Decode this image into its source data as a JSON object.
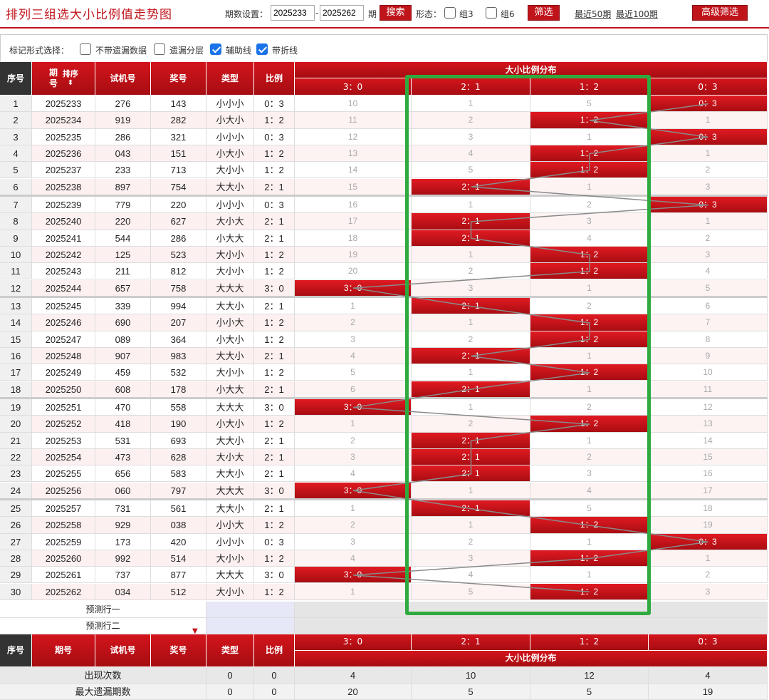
{
  "title": "排列三组选大小比例值走势图",
  "toolbar": {
    "period_label": "期数设置：",
    "from_value": "2025233",
    "dash": "-",
    "to_value": "2025262",
    "period_suffix": "期",
    "search_label": "搜索",
    "shape_label": "形态：",
    "group3_label": "组3",
    "group6_label": "组6",
    "filter_label": "筛选",
    "recent50_label": "最近50期",
    "recent100_label": "最近100期",
    "advanced_label": "高级筛选"
  },
  "options": {
    "label": "标记形式选择：",
    "items": [
      {
        "label": "不带遗漏数据",
        "checked": false
      },
      {
        "label": "遗漏分层",
        "checked": false
      },
      {
        "label": "辅助线",
        "checked": true
      },
      {
        "label": "带折线",
        "checked": true
      }
    ]
  },
  "header": {
    "seq": "序号",
    "period": "期号",
    "sort": "排序",
    "trial": "试机号",
    "prize": "奖号",
    "type": "类型",
    "ratio": "比例",
    "dist_title": "大小比例分布",
    "dist_cols": [
      "3：0",
      "2：1",
      "1：2",
      "0：3"
    ]
  },
  "colors": {
    "brand_red": "#c0141b",
    "highlight_green": "#2faa3f"
  },
  "rows": [
    {
      "seq": "1",
      "period": "2025233",
      "trial": "276",
      "prize": "143",
      "type": "小小小",
      "ratio": "0：3",
      "dist": [
        "10",
        "1",
        "5",
        "0：3"
      ],
      "hit": 3
    },
    {
      "seq": "2",
      "period": "2025234",
      "trial": "919",
      "prize": "282",
      "type": "小大小",
      "ratio": "1：2",
      "dist": [
        "11",
        "2",
        "1：2",
        "1"
      ],
      "hit": 2
    },
    {
      "seq": "3",
      "period": "2025235",
      "trial": "286",
      "prize": "321",
      "type": "小小小",
      "ratio": "0：3",
      "dist": [
        "12",
        "3",
        "1",
        "0：3"
      ],
      "hit": 3
    },
    {
      "seq": "4",
      "period": "2025236",
      "trial": "043",
      "prize": "151",
      "type": "小大小",
      "ratio": "1：2",
      "dist": [
        "13",
        "4",
        "1：2",
        "1"
      ],
      "hit": 2
    },
    {
      "seq": "5",
      "period": "2025237",
      "trial": "233",
      "prize": "713",
      "type": "大小小",
      "ratio": "1：2",
      "dist": [
        "14",
        "5",
        "1：2",
        "2"
      ],
      "hit": 2
    },
    {
      "seq": "6",
      "period": "2025238",
      "trial": "897",
      "prize": "754",
      "type": "大大小",
      "ratio": "2：1",
      "dist": [
        "15",
        "2：1",
        "1",
        "3"
      ],
      "hit": 1
    },
    {
      "seq": "7",
      "period": "2025239",
      "trial": "779",
      "prize": "220",
      "type": "小小小",
      "ratio": "0：3",
      "dist": [
        "16",
        "1",
        "2",
        "0：3"
      ],
      "hit": 3
    },
    {
      "seq": "8",
      "period": "2025240",
      "trial": "220",
      "prize": "627",
      "type": "大小大",
      "ratio": "2：1",
      "dist": [
        "17",
        "2：1",
        "3",
        "1"
      ],
      "hit": 1
    },
    {
      "seq": "9",
      "period": "2025241",
      "trial": "544",
      "prize": "286",
      "type": "小大大",
      "ratio": "2：1",
      "dist": [
        "18",
        "2：1",
        "4",
        "2"
      ],
      "hit": 1
    },
    {
      "seq": "10",
      "period": "2025242",
      "trial": "125",
      "prize": "523",
      "type": "大小小",
      "ratio": "1：2",
      "dist": [
        "19",
        "1",
        "1：2",
        "3"
      ],
      "hit": 2
    },
    {
      "seq": "11",
      "period": "2025243",
      "trial": "211",
      "prize": "812",
      "type": "大小小",
      "ratio": "1：2",
      "dist": [
        "20",
        "2",
        "1：2",
        "4"
      ],
      "hit": 2
    },
    {
      "seq": "12",
      "period": "2025244",
      "trial": "657",
      "prize": "758",
      "type": "大大大",
      "ratio": "3：0",
      "dist": [
        "3：0",
        "3",
        "1",
        "5"
      ],
      "hit": 0
    },
    {
      "seq": "13",
      "period": "2025245",
      "trial": "339",
      "prize": "994",
      "type": "大大小",
      "ratio": "2：1",
      "dist": [
        "1",
        "2：1",
        "2",
        "6"
      ],
      "hit": 1
    },
    {
      "seq": "14",
      "period": "2025246",
      "trial": "690",
      "prize": "207",
      "type": "小小大",
      "ratio": "1：2",
      "dist": [
        "2",
        "1",
        "1：2",
        "7"
      ],
      "hit": 2
    },
    {
      "seq": "15",
      "period": "2025247",
      "trial": "089",
      "prize": "364",
      "type": "小大小",
      "ratio": "1：2",
      "dist": [
        "3",
        "2",
        "1：2",
        "8"
      ],
      "hit": 2
    },
    {
      "seq": "16",
      "period": "2025248",
      "trial": "907",
      "prize": "983",
      "type": "大大小",
      "ratio": "2：1",
      "dist": [
        "4",
        "2：1",
        "1",
        "9"
      ],
      "hit": 1
    },
    {
      "seq": "17",
      "period": "2025249",
      "trial": "459",
      "prize": "532",
      "type": "大小小",
      "ratio": "1：2",
      "dist": [
        "5",
        "1",
        "1：2",
        "10"
      ],
      "hit": 2
    },
    {
      "seq": "18",
      "period": "2025250",
      "trial": "608",
      "prize": "178",
      "type": "小大大",
      "ratio": "2：1",
      "dist": [
        "6",
        "2：1",
        "1",
        "11"
      ],
      "hit": 1
    },
    {
      "seq": "19",
      "period": "2025251",
      "trial": "470",
      "prize": "558",
      "type": "大大大",
      "ratio": "3：0",
      "dist": [
        "3：0",
        "1",
        "2",
        "12"
      ],
      "hit": 0
    },
    {
      "seq": "20",
      "period": "2025252",
      "trial": "418",
      "prize": "190",
      "type": "小大小",
      "ratio": "1：2",
      "dist": [
        "1",
        "2",
        "1：2",
        "13"
      ],
      "hit": 2
    },
    {
      "seq": "21",
      "period": "2025253",
      "trial": "531",
      "prize": "693",
      "type": "大大小",
      "ratio": "2：1",
      "dist": [
        "2",
        "2：1",
        "1",
        "14"
      ],
      "hit": 1
    },
    {
      "seq": "22",
      "period": "2025254",
      "trial": "473",
      "prize": "628",
      "type": "大小大",
      "ratio": "2：1",
      "dist": [
        "3",
        "2：1",
        "2",
        "15"
      ],
      "hit": 1
    },
    {
      "seq": "23",
      "period": "2025255",
      "trial": "656",
      "prize": "583",
      "type": "大大小",
      "ratio": "2：1",
      "dist": [
        "4",
        "2：1",
        "3",
        "16"
      ],
      "hit": 1
    },
    {
      "seq": "24",
      "period": "2025256",
      "trial": "060",
      "prize": "797",
      "type": "大大大",
      "ratio": "3：0",
      "dist": [
        "3：0",
        "1",
        "4",
        "17"
      ],
      "hit": 0
    },
    {
      "seq": "25",
      "period": "2025257",
      "trial": "731",
      "prize": "561",
      "type": "大大小",
      "ratio": "2：1",
      "dist": [
        "1",
        "2：1",
        "5",
        "18"
      ],
      "hit": 1
    },
    {
      "seq": "26",
      "period": "2025258",
      "trial": "929",
      "prize": "038",
      "type": "小小大",
      "ratio": "1：2",
      "dist": [
        "2",
        "1",
        "1：2",
        "19"
      ],
      "hit": 2
    },
    {
      "seq": "27",
      "period": "2025259",
      "trial": "173",
      "prize": "420",
      "type": "小小小",
      "ratio": "0：3",
      "dist": [
        "3",
        "2",
        "1",
        "0：3"
      ],
      "hit": 3
    },
    {
      "seq": "28",
      "period": "2025260",
      "trial": "992",
      "prize": "514",
      "type": "大小小",
      "ratio": "1：2",
      "dist": [
        "4",
        "3",
        "1：2",
        "1"
      ],
      "hit": 2
    },
    {
      "seq": "29",
      "period": "2025261",
      "trial": "737",
      "prize": "877",
      "type": "大大大",
      "ratio": "3：0",
      "dist": [
        "3：0",
        "4",
        "1",
        "2"
      ],
      "hit": 0
    },
    {
      "seq": "30",
      "period": "2025262",
      "trial": "034",
      "prize": "512",
      "type": "大小小",
      "ratio": "1：2",
      "dist": [
        "1",
        "5",
        "1：2",
        "3"
      ],
      "hit": 2
    }
  ],
  "predict": {
    "row1": "预测行一",
    "row2": "预测行二"
  },
  "stats": [
    {
      "label": "出现次数",
      "type": "0",
      "ratio": "0",
      "dist": [
        "4",
        "10",
        "12",
        "4"
      ]
    },
    {
      "label": "最大遗漏期数",
      "type": "0",
      "ratio": "0",
      "dist": [
        "20",
        "5",
        "5",
        "19"
      ]
    }
  ]
}
